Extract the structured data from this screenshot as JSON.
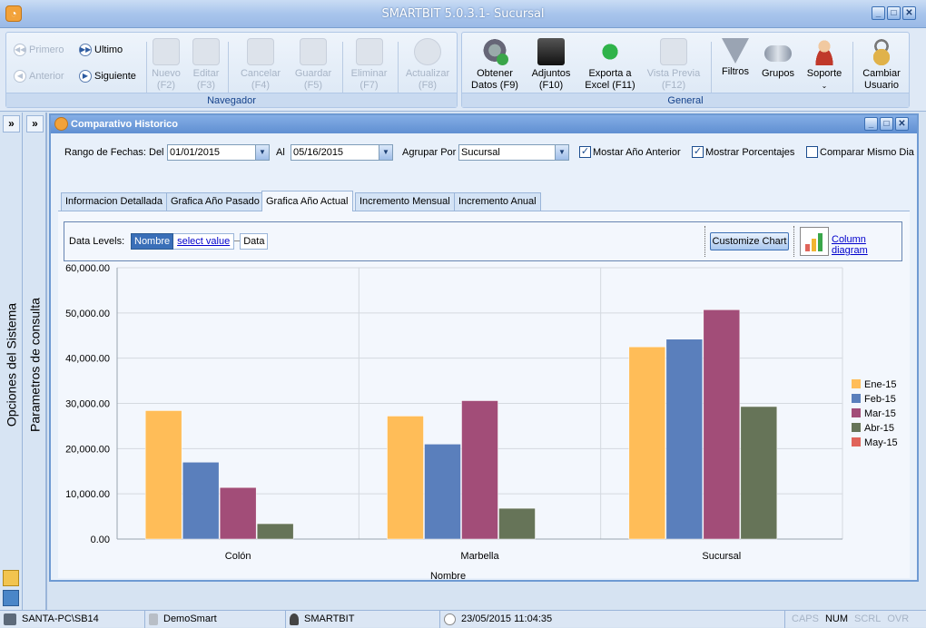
{
  "window": {
    "title": "SMARTBIT 5.0.3.1- Sucursal"
  },
  "nav": {
    "primero": "Primero",
    "anterior": "Anterior",
    "ultimo": "Ultimo",
    "siguiente": "Siguiente",
    "nuevo": "Nuevo",
    "nuevo_key": "(F2)",
    "editar": "Editar",
    "editar_key": "(F3)",
    "cancelar": "Cancelar",
    "cancelar_key": "(F4)",
    "guardar": "Guardar",
    "guardar_key": "(F5)",
    "eliminar": "Eliminar",
    "eliminar_key": "(F7)",
    "actualizar": "Actualizar",
    "actualizar_key": "(F8)",
    "group_label": "Navegador"
  },
  "general": {
    "obtener1": "Obtener",
    "obtener2": "Datos (F9)",
    "adjuntos1": "Adjuntos",
    "adjuntos2": "(F10)",
    "exporta1": "Exporta a",
    "exporta2": "Excel (F11)",
    "vista1": "Vista Previa",
    "vista2": "(F12)",
    "filtros": "Filtros",
    "grupos": "Grupos",
    "soporte": "Soporte",
    "cambiar1": "Cambiar",
    "cambiar2": "Usuario",
    "group_label": "General"
  },
  "side": {
    "opciones": "Opciones del Sistema",
    "parametros": "Parametros de consulta",
    "btn1": "»",
    "btn2": "»"
  },
  "child": {
    "title": "Comparativo Historico"
  },
  "filters": {
    "rango": "Rango de Fechas:",
    "del": "Del",
    "del_value": "01/01/2015",
    "al": "Al",
    "al_value": "05/16/2015",
    "agrupar": "Agrupar Por",
    "agrupar_value": "Sucursal",
    "mostrar_anio": "Mostar Año Anterior",
    "mostrar_pct": "Mostrar Porcentajes",
    "comparar": "Comparar Mismo Dia"
  },
  "tabs": [
    "Informacion Detallada",
    "Grafica Año Pasado",
    "Grafica Año Actual",
    "Incremento Mensual",
    "Incremento Anual"
  ],
  "datalevels": {
    "label": "Data Levels:",
    "nombre": "Nombre",
    "select": "select value",
    "data": "Data",
    "customize": "Customize Chart",
    "diagram": "Column diagram"
  },
  "colors": {
    "ene": "#ffbd58",
    "feb": "#5a7fbc",
    "mar": "#a24d78",
    "abr": "#667458",
    "may": "#e0645a"
  },
  "chart_data": {
    "type": "bar",
    "categories": [
      "Colón",
      "Marbella",
      "Sucursal"
    ],
    "series": [
      {
        "name": "Ene-15",
        "values": [
          28400,
          27200,
          42500
        ]
      },
      {
        "name": "Feb-15",
        "values": [
          17000,
          21000,
          44200
        ]
      },
      {
        "name": "Mar-15",
        "values": [
          11400,
          30600,
          50700
        ]
      },
      {
        "name": "Abr-15",
        "values": [
          3400,
          6800,
          29300
        ]
      },
      {
        "name": "May-15",
        "values": [
          0,
          0,
          0
        ]
      }
    ],
    "yticks": [
      "0.00",
      "10,000.00",
      "20,000.00",
      "30,000.00",
      "40,000.00",
      "50,000.00",
      "60,000.00"
    ],
    "ylim": [
      0,
      60000
    ],
    "xlabel": "Nombre",
    "ylabel": "",
    "grid": true,
    "legend": "right"
  },
  "status": {
    "pc": "SANTA-PC\\SB14",
    "db": "DemoSmart",
    "user": "SMARTBIT",
    "datetime": "23/05/2015 11:04:35",
    "caps": "CAPS",
    "num": "NUM",
    "scrl": "SCRL",
    "ovr": "OVR"
  }
}
